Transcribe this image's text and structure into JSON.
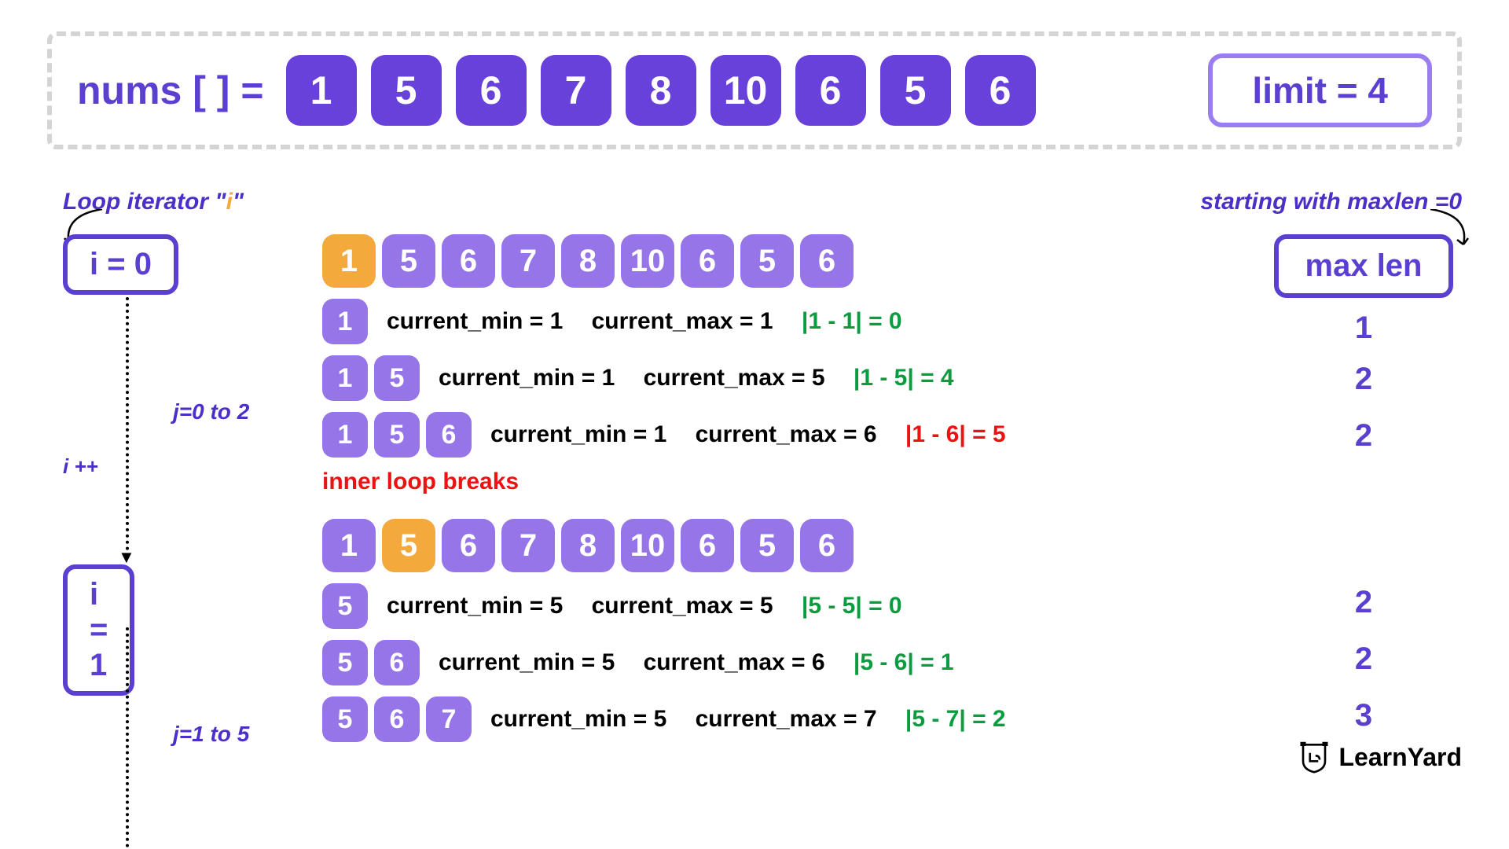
{
  "header": {
    "nums_label": "nums [ ] =",
    "nums": [
      "1",
      "5",
      "6",
      "7",
      "8",
      "10",
      "6",
      "5",
      "6"
    ],
    "limit_text": "limit = 4"
  },
  "ann": {
    "loop_iter": "Loop iterator \"",
    "loop_iter_i": "i",
    "loop_iter_end": "\"",
    "starting_maxlen": "starting with maxlen =0",
    "maxlen_label": "max len",
    "i_plus": "i ++"
  },
  "iter0": {
    "i_label": "i = 0",
    "j_label": "j=0 to 2",
    "array": {
      "values": [
        "1",
        "5",
        "6",
        "7",
        "8",
        "10",
        "6",
        "5",
        "6"
      ],
      "highlight_index": 0
    },
    "steps": [
      {
        "prefix": [
          "1"
        ],
        "cmin": "current_min = 1",
        "cmax": "current_max = 1",
        "diff": "|1 - 1| = 0",
        "diff_color": "green",
        "maxlen": "1"
      },
      {
        "prefix": [
          "1",
          "5"
        ],
        "cmin": "current_min = 1",
        "cmax": "current_max = 5",
        "diff": "|1 - 5| = 4",
        "diff_color": "green",
        "maxlen": "2"
      },
      {
        "prefix": [
          "1",
          "5",
          "6"
        ],
        "cmin": "current_min = 1",
        "cmax": "current_max = 6",
        "diff": "|1 - 6| = 5",
        "diff_color": "red",
        "maxlen": "2"
      }
    ],
    "breaks": "inner loop breaks"
  },
  "iter1": {
    "i_label": "i = 1",
    "j_label": "j=1 to 5",
    "array": {
      "values": [
        "1",
        "5",
        "6",
        "7",
        "8",
        "10",
        "6",
        "5",
        "6"
      ],
      "highlight_index": 1
    },
    "steps": [
      {
        "prefix": [
          "5"
        ],
        "cmin": "current_min = 5",
        "cmax": "current_max = 5",
        "diff": "|5 - 5| = 0",
        "diff_color": "green",
        "maxlen": "2"
      },
      {
        "prefix": [
          "5",
          "6"
        ],
        "cmin": "current_min = 5",
        "cmax": "current_max = 6",
        "diff": "|5 - 6| = 1",
        "diff_color": "green",
        "maxlen": "2"
      },
      {
        "prefix": [
          "5",
          "6",
          "7"
        ],
        "cmin": "current_min = 5",
        "cmax": "current_max = 7",
        "diff": "|5 - 7| = 2",
        "diff_color": "green",
        "maxlen": "3"
      }
    ]
  },
  "logo": {
    "text": "LearnYard"
  }
}
